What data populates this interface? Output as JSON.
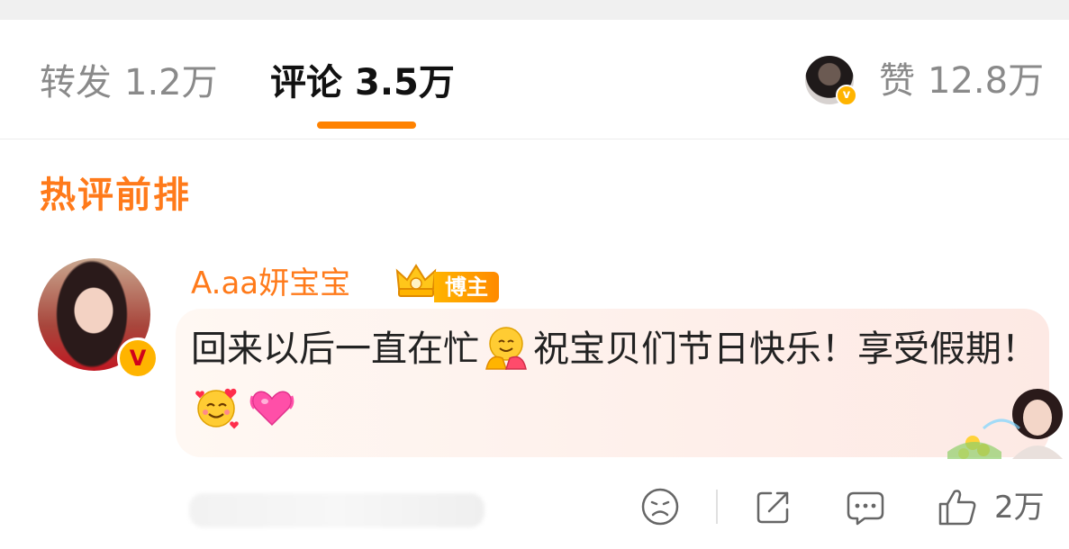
{
  "tabs": {
    "repost": {
      "label": "转发",
      "count": "1.2万"
    },
    "comment": {
      "label": "评论",
      "count": "3.5万",
      "active": true
    },
    "likes": {
      "label": "赞",
      "count": "12.8万"
    }
  },
  "section_title": "热评前排",
  "comment": {
    "username": "A.aa妍宝宝",
    "badge": "博主",
    "text_part1": "回来以后一直在忙",
    "text_part2": "祝宝贝们节日快乐！享受假期！",
    "emojis": [
      "hugging-face-emoji",
      "smiling-face-with-hearts-emoji",
      "beating-heart-emoji"
    ]
  },
  "actions": {
    "like_count": "2万"
  },
  "colors": {
    "accent": "#ff8200",
    "username": "#ff7a1a",
    "badge_gold": "#ffb400"
  }
}
